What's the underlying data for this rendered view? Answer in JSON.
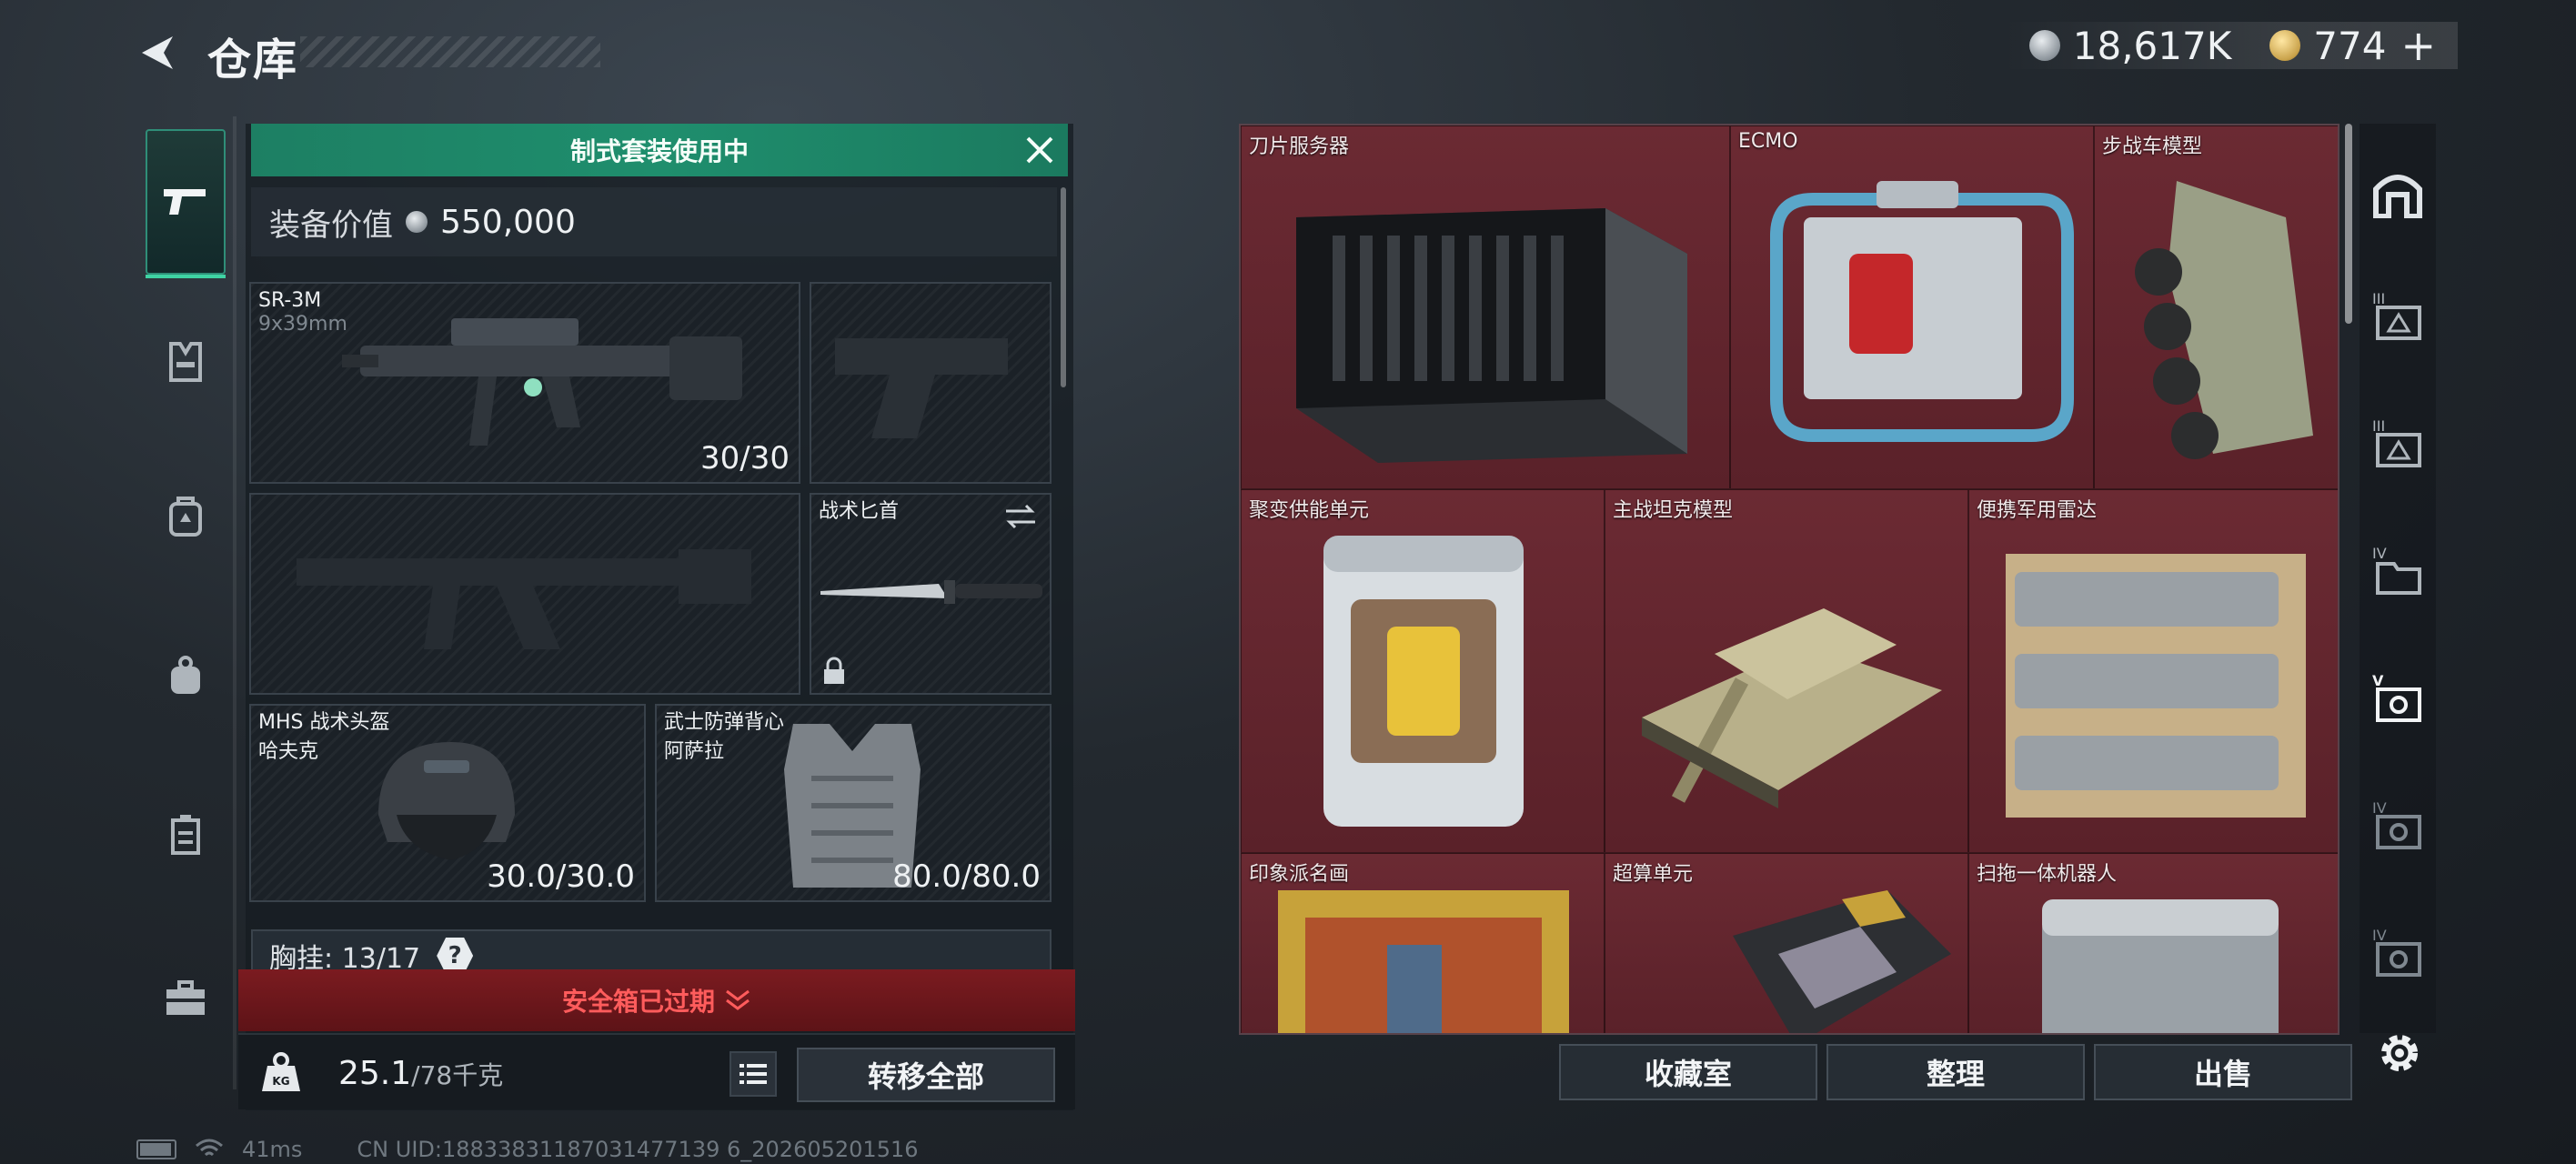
{
  "header": {
    "title": "仓库",
    "silver_amount": "18,617K",
    "gold_amount": "774",
    "add_symbol": "+"
  },
  "left_nav": {
    "items": [
      {
        "icon": "pistol-icon",
        "active": true
      },
      {
        "icon": "rig-icon",
        "active": false
      },
      {
        "icon": "backpack-icon",
        "active": false
      },
      {
        "icon": "pouch-icon",
        "active": false
      },
      {
        "icon": "case-icon",
        "active": false
      },
      {
        "icon": "toolbox-icon",
        "active": false
      }
    ]
  },
  "kit": {
    "banner": "制式套装使用中",
    "value_label": "装备价值",
    "value": "550,000"
  },
  "slots": {
    "primary": {
      "name": "SR-3M",
      "caliber": "9x39mm",
      "ammo": "30/30"
    },
    "knife": {
      "name": "战术匕首"
    },
    "helmet": {
      "name": "MHS 战术头盔",
      "sub": "哈夫克",
      "durability": "30.0/30.0"
    },
    "armor": {
      "name": "武士防弹背心",
      "sub": "阿萨拉",
      "durability": "80.0/80.0"
    }
  },
  "chest_rig": {
    "label": "胸挂",
    "capacity": "13/17",
    "help": "?"
  },
  "safebox": {
    "text": "安全箱已过期"
  },
  "weight": {
    "current": "25.1",
    "max": "/78千克",
    "kg_badge": "KG"
  },
  "buttons": {
    "transfer_all": "转移全部",
    "collection": "收藏室",
    "organize": "整理",
    "sell": "出售"
  },
  "warehouse": {
    "items": [
      {
        "name": "刀片服务器"
      },
      {
        "name": "ECMO"
      },
      {
        "name": "步战车模型"
      },
      {
        "name": "聚变供能单元"
      },
      {
        "name": "主战坦克模型"
      },
      {
        "name": "便携军用雷达"
      },
      {
        "name": "印象派名画"
      },
      {
        "name": "超算单元"
      },
      {
        "name": "扫拖一体机器人"
      }
    ]
  },
  "right_tabs": [
    {
      "icon": "home-icon"
    },
    {
      "icon": "tier3-container-icon",
      "tier": "III"
    },
    {
      "icon": "tier3-container-icon",
      "tier": "III"
    },
    {
      "icon": "tier4-box-icon",
      "tier": "IV"
    },
    {
      "icon": "tier5-crate-icon",
      "tier": "V",
      "active": true
    },
    {
      "icon": "tier4-crate-icon",
      "tier": "IV"
    },
    {
      "icon": "tier4-crate-icon",
      "tier": "IV"
    }
  ],
  "status": {
    "ping": "41ms",
    "uid": "CN UID:18833831187031477139 6_202605201516"
  },
  "colors": {
    "accent_green": "#1f8e6d",
    "warehouse_bg": "#5a2129",
    "expired_red": "#ff5c5c"
  }
}
